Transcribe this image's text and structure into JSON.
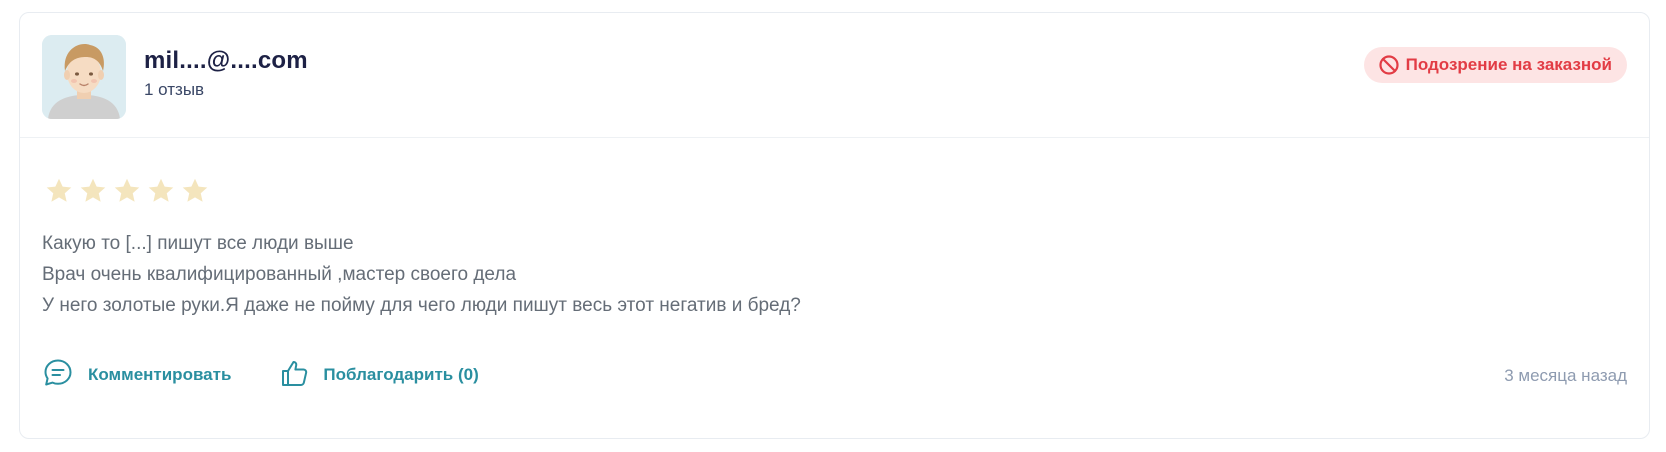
{
  "review": {
    "user": {
      "name": "mil....@....com",
      "review_count": "1 отзыв"
    },
    "badge": {
      "label": "Подозрение на заказной",
      "icon": "ban-icon",
      "color": "#e23c45",
      "background": "#fde4e4"
    },
    "rating": {
      "stars": 5,
      "filled": 5,
      "star_color": "#f4e5bd"
    },
    "text_lines": [
      "Какую то [...] пишут все люди выше",
      "Врач очень квалифицированный ,мастер своего дела",
      "У него золотые руки.Я даже не пойму для чего люди пишут весь этот негатив и бред?"
    ],
    "actions": {
      "comment_label": "Комментировать",
      "comment_icon": "comment-icon",
      "thank_label": "Поблагодарить (0)",
      "thank_icon": "thumbs-up-icon",
      "accent_color": "#2a8fa0"
    },
    "timestamp": "3 месяца назад"
  }
}
